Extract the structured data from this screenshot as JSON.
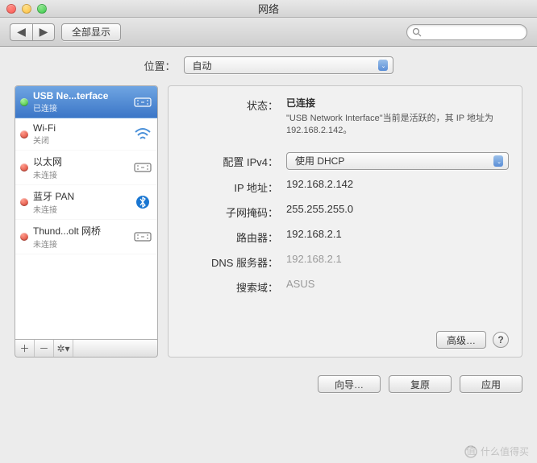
{
  "window": {
    "title": "网络"
  },
  "toolbar": {
    "show_all": "全部显示"
  },
  "location": {
    "label": "位置：",
    "value": "自动"
  },
  "sidebar": {
    "items": [
      {
        "name": "USB Ne...terface",
        "status": "已连接",
        "dot": "green",
        "icon": "ethernet"
      },
      {
        "name": "Wi-Fi",
        "status": "关闭",
        "dot": "red",
        "icon": "wifi"
      },
      {
        "name": "以太网",
        "status": "未连接",
        "dot": "red",
        "icon": "ethernet"
      },
      {
        "name": "蓝牙 PAN",
        "status": "未连接",
        "dot": "red",
        "icon": "bluetooth"
      },
      {
        "name": "Thund...olt 网桥",
        "status": "未连接",
        "dot": "red",
        "icon": "ethernet"
      }
    ]
  },
  "detail": {
    "status_label": "状态：",
    "status_value": "已连接",
    "status_desc": "\"USB Network Interface\"当前是活跃的，其 IP 地址为 192.168.2.142。",
    "ipv4_label": "配置 IPv4：",
    "ipv4_value": "使用 DHCP",
    "ip_label": "IP 地址：",
    "ip_value": "192.168.2.142",
    "mask_label": "子网掩码：",
    "mask_value": "255.255.255.0",
    "router_label": "路由器：",
    "router_value": "192.168.2.1",
    "dns_label": "DNS 服务器：",
    "dns_value": "192.168.2.1",
    "search_label": "搜索域：",
    "search_value": "ASUS",
    "advanced": "高级…"
  },
  "footer": {
    "assist": "向导…",
    "revert": "复原",
    "apply": "应用"
  },
  "watermark": "什么值得买"
}
